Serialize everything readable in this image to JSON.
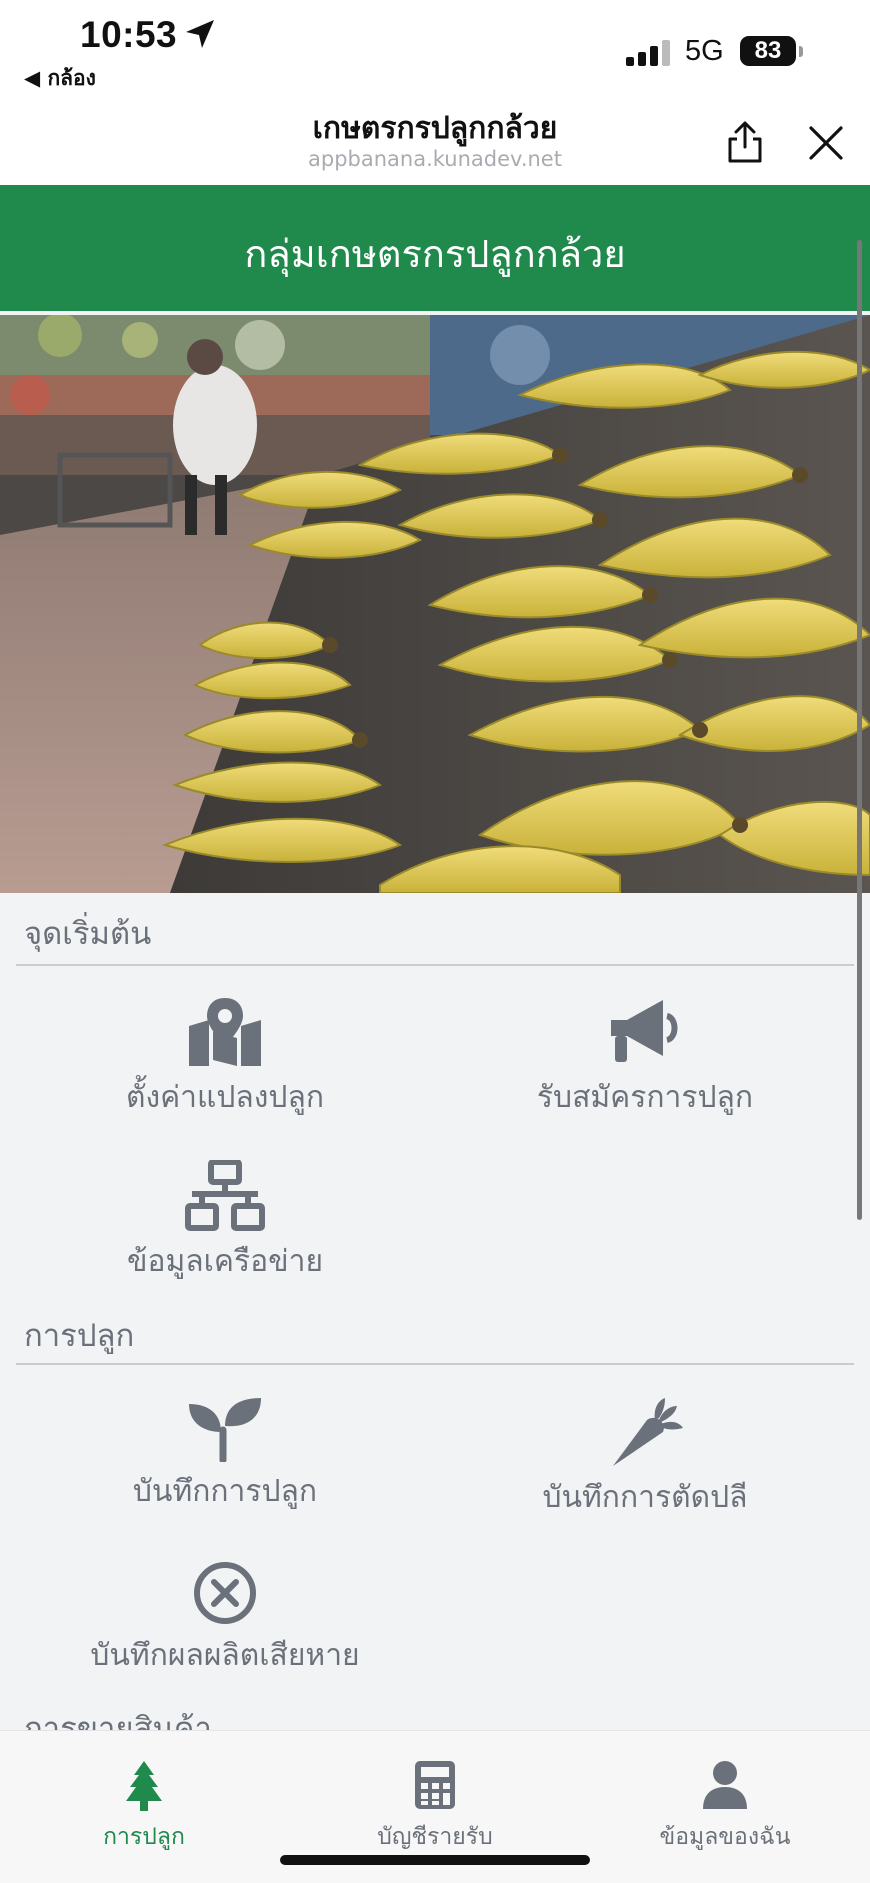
{
  "status_bar": {
    "time": "10:53",
    "back_app": "◀ กล้อง",
    "network": "5G",
    "battery": "83"
  },
  "browser": {
    "title": "เกษตรกรปลูกกล้วย",
    "url": "appbanana.kunadev.net"
  },
  "app": {
    "title": "กลุ่มเกษตรกรปลูกกล้วย"
  },
  "sections": [
    {
      "title": "จุดเริ่มต้น",
      "items": [
        {
          "label": "ตั้งค่าแปลงปลูก",
          "icon": "map-marker-icon"
        },
        {
          "label": "รับสมัครการปลูก",
          "icon": "megaphone-icon"
        },
        {
          "label": "ข้อมูลเครือข่าย",
          "icon": "network-icon"
        }
      ]
    },
    {
      "title": "การปลูก",
      "items": [
        {
          "label": "บันทึกการปลูก",
          "icon": "seedling-icon"
        },
        {
          "label": "บันทึกการตัดปลี",
          "icon": "carrot-icon"
        },
        {
          "label": "บันทึกผลผลิตเสียหาย",
          "icon": "circle-x-icon"
        }
      ]
    },
    {
      "title": "การขายสินค้า"
    }
  ],
  "tabs": [
    {
      "label": "การปลูก",
      "icon": "tree-icon",
      "active": true
    },
    {
      "label": "บัญชีรายรับ",
      "icon": "calculator-icon",
      "active": false
    },
    {
      "label": "ข้อมูลของฉัน",
      "icon": "user-icon",
      "active": false
    }
  ],
  "colors": {
    "brand_green": "#1f8a4c",
    "icon_gray": "#6b717a",
    "background": "#f2f3f5"
  }
}
